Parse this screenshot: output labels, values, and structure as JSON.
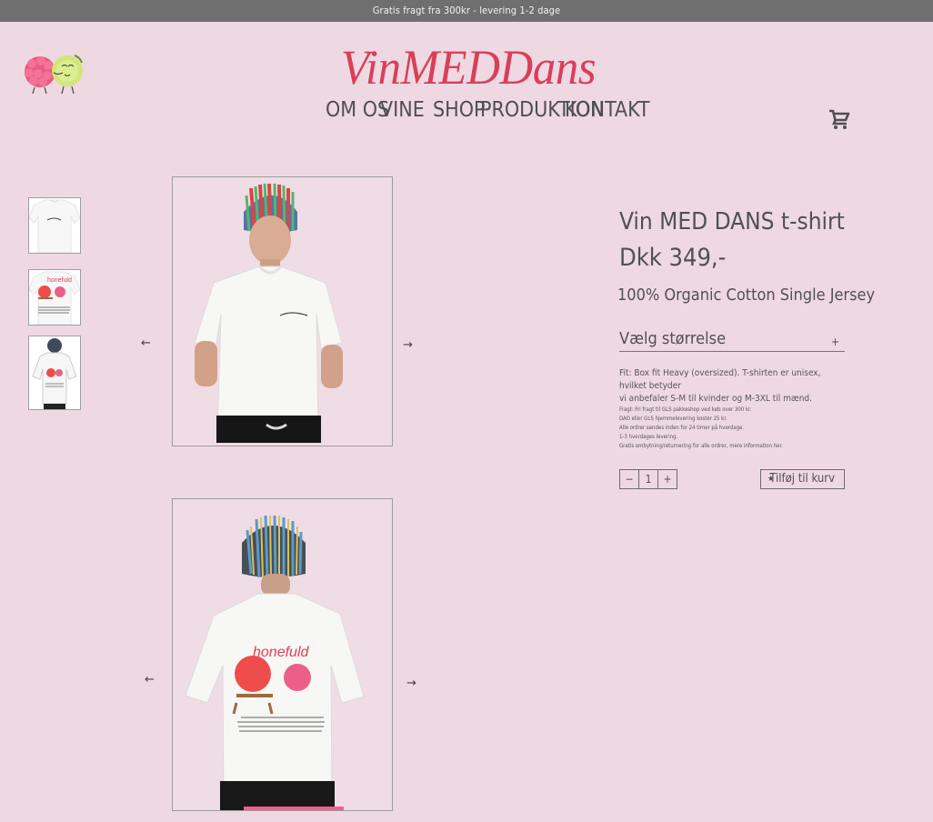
{
  "announcement": "Gratis fragt fra 300kr - levering 1-2 dage",
  "brand": {
    "name": "VinMEDDans"
  },
  "nav": {
    "items": [
      "Om os",
      "vine",
      "shop",
      "produktion",
      "kontakt"
    ]
  },
  "carousel": {
    "prev_symbol": "←",
    "next_symbol": "→"
  },
  "product": {
    "title": "Vin MED DANS t-shirt",
    "price": "Dkk 349,-",
    "material": "100% Organic Cotton Single Jersey",
    "size_label": "Vælg størrelse",
    "size_toggle": "+",
    "description_lines": [
      "Fit: Box fit Heavy (oversized). T-shirten er unisex, hvilket betyder",
      "vi anbefaler S-M til kvinder og M-3XL til mænd."
    ],
    "shipping_lines": [
      "Fragt: Fri fragt til GLS pakkeshop ved køb over 300 kr.",
      "DAO eller GLS hjemmelevering koster 25 kr.",
      "Alle ordrer sendes inden for 24 timer på hverdage.",
      "1-3 hverdages levering.",
      "Gratis ombytning/returnering for alle ordrer, mere information her."
    ],
    "quantity": {
      "minus": "−",
      "value": "1",
      "plus": "+"
    },
    "add_to_cart": {
      "label": "Tilføj til kurv",
      "icon": "star-icon"
    }
  },
  "icons": {
    "cart": "shopping-cart-icon"
  },
  "colors": {
    "background": "#eed9e3",
    "announcement_bar": "#6f6f6f",
    "brand": "#d93f5a",
    "text": "#515151"
  }
}
